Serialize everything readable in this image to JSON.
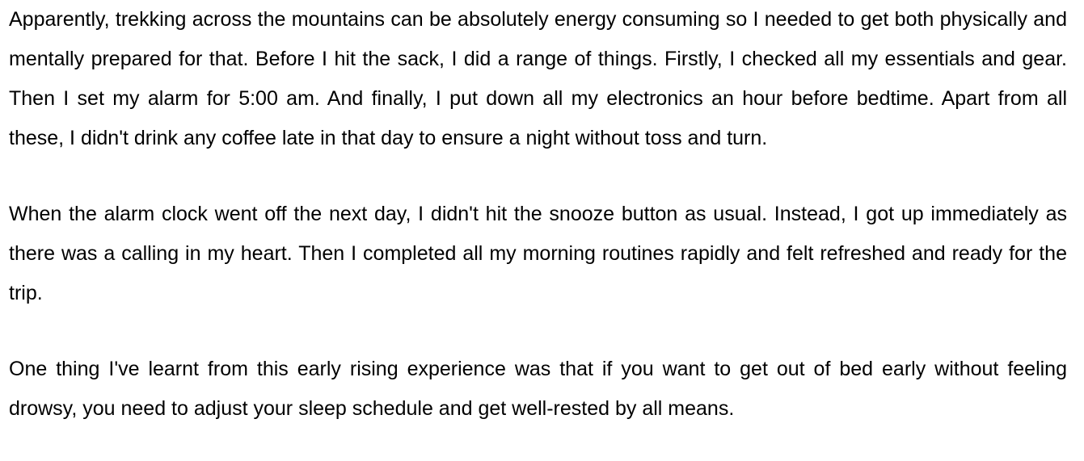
{
  "document": {
    "paragraphs": [
      "Apparently, trekking across the mountains can be absolutely energy consuming so I needed to get both physically and mentally prepared for that. Before I hit the sack, I did a range of things. Firstly, I checked all my essentials and gear. Then I set my alarm for 5:00 am. And finally, I put down all my electronics an hour before bedtime. Apart from all these, I didn't drink any coffee late in that day to ensure a night without toss and turn.",
      "When the alarm clock went off the next day, I didn't hit the snooze button as usual. Instead, I got up immediately as there was a calling in my heart. Then I completed all my morning routines rapidly and felt refreshed and ready for the trip.",
      "One thing I've learnt from this early rising experience was that if you want to get out of bed early without feeling drowsy, you need to adjust your sleep schedule and get well-rested by all means."
    ]
  }
}
